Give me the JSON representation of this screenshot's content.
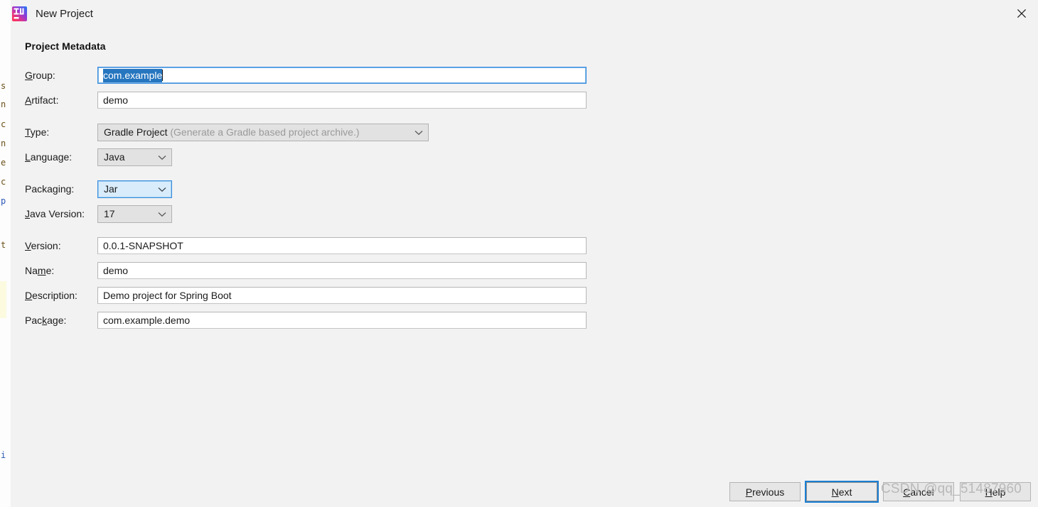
{
  "window": {
    "title": "New Project",
    "app_icon": "intellij-idea-icon",
    "close_icon": "close-icon"
  },
  "section": {
    "heading": "Project Metadata"
  },
  "fields": {
    "group": {
      "label_pre": "",
      "label_mnemonic": "G",
      "label_post": "roup:",
      "value": "com.example",
      "selected": true
    },
    "artifact": {
      "label_pre": "",
      "label_mnemonic": "A",
      "label_post": "rtifact:",
      "value": "demo"
    },
    "type": {
      "label_pre": "",
      "label_mnemonic": "T",
      "label_post": "ype:",
      "value": "Gradle Project",
      "hint": "(Generate a Gradle based project archive.)"
    },
    "language": {
      "label_pre": "",
      "label_mnemonic": "L",
      "label_post": "anguage:",
      "value": "Java"
    },
    "packaging": {
      "label_pre": "Packa",
      "label_mnemonic": "g",
      "label_post": "ing:",
      "value": "Jar"
    },
    "java_version": {
      "label_pre": "",
      "label_mnemonic": "J",
      "label_post": "ava Version:",
      "value": "17"
    },
    "version": {
      "label_pre": "",
      "label_mnemonic": "V",
      "label_post": "ersion:",
      "value": "0.0.1-SNAPSHOT"
    },
    "name": {
      "label_pre": "Na",
      "label_mnemonic": "m",
      "label_post": "e:",
      "value": "demo"
    },
    "description": {
      "label_pre": "",
      "label_mnemonic": "D",
      "label_post": "escription:",
      "value": "Demo project for Spring Boot"
    },
    "package": {
      "label_pre": "Pac",
      "label_mnemonic": "k",
      "label_post": "age:",
      "value": "com.example.demo"
    }
  },
  "footer": {
    "previous": {
      "pre": "",
      "mnemonic": "P",
      "post": "revious"
    },
    "next": {
      "pre": "",
      "mnemonic": "N",
      "post": "ext"
    },
    "cancel": {
      "pre": "",
      "mnemonic": "C",
      "post": "ancel"
    },
    "help": {
      "pre": "",
      "mnemonic": "H",
      "post": "elp"
    }
  },
  "watermark": {
    "text": "CSDN @qq_51487960"
  },
  "background_sliver": {
    "lines": [
      "s",
      "n",
      "c",
      "n",
      "e",
      "c",
      "p",
      "t",
      "i"
    ]
  },
  "colors": {
    "dialog_bg": "#f2f2f2",
    "input_bg": "#ffffff",
    "focus_blue": "#3b8ede",
    "selection_blue": "#2675bf",
    "combo_bg": "#e2e2e2",
    "combo_highlight_bg": "#d9ecfb",
    "hint_gray": "#9a9a9a",
    "watermark_gray": "#b9b9b9"
  }
}
